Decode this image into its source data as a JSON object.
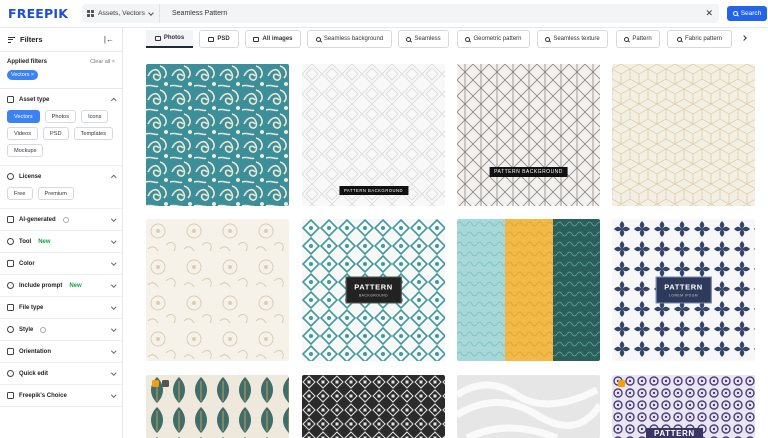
{
  "header": {
    "logo": "FREEPIK",
    "scope_label": "Assets, Vectors",
    "search_value": "Seamless Pattern",
    "clear_icon": "close-icon",
    "search_button": "Search",
    "brand_color": "#1d4ed8",
    "accent_color": "#2563eb"
  },
  "sidebar": {
    "title": "Filters",
    "collapse_glyph": "|←",
    "applied_label": "Applied filters",
    "clear_all": "Clear all ×",
    "applied_chip": "Vectors ×",
    "asset_type": {
      "label": "Asset type",
      "options": [
        "Vectors",
        "Photos",
        "Icons",
        "Videos",
        "PSD",
        "Templates",
        "Mockups"
      ],
      "selected": "Vectors"
    },
    "license": {
      "label": "License",
      "options": [
        "Free",
        "Premium"
      ]
    },
    "sections": [
      {
        "label": "AI-generated",
        "new": "",
        "info": true
      },
      {
        "label": "Tool",
        "new": "New",
        "info": false
      },
      {
        "label": "Color",
        "new": "",
        "info": false
      },
      {
        "label": "Include prompt",
        "new": "New",
        "info": false
      },
      {
        "label": "File type",
        "new": "",
        "info": false
      },
      {
        "label": "Style",
        "new": "",
        "info": true
      },
      {
        "label": "Orientation",
        "new": "",
        "info": false
      },
      {
        "label": "Quick edit",
        "new": "",
        "info": false
      },
      {
        "label": "Freepik's Choice",
        "new": "",
        "info": false
      }
    ]
  },
  "tabs": [
    "Photos",
    "PSD",
    "All images",
    "Seamless background",
    "Seamless",
    "Geometric pattern",
    "Seamless texture",
    "Pattern",
    "Fabric pattern"
  ],
  "results": {
    "captions": {
      "card2": "PATTERN BACKGROUND",
      "card3": "PATTERN BACKGROUND",
      "card6_title": "PATTERN",
      "card6_sub": "BACKGROUND",
      "card8_title": "PATTERN",
      "card8_sub": "LOREM IPSUM",
      "card12_title": "PATTERN"
    }
  }
}
